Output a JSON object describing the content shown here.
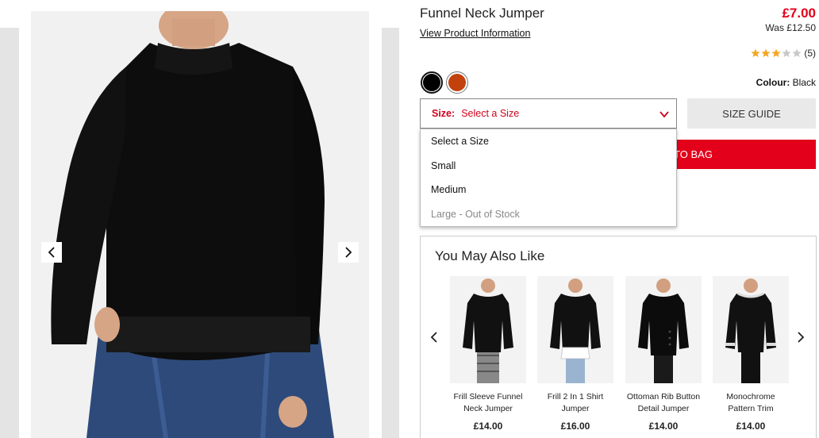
{
  "product": {
    "title": "Funnel Neck Jumper",
    "info_link": "View Product Information",
    "price": "£7.00",
    "was_price": "Was £12.50",
    "rating": 3,
    "rating_max": 5,
    "review_count": "(5)",
    "colour_label": "Colour:",
    "colour_value": "Black",
    "swatches": [
      {
        "name": "Black",
        "color": "#000000"
      },
      {
        "name": "Rust",
        "color": "#c2410c"
      }
    ]
  },
  "size": {
    "label": "Size:",
    "value": "Select a Size",
    "options": [
      "Select a Size",
      "Small",
      "Medium",
      "Large - Out of Stock"
    ],
    "guide": "SIZE GUIDE"
  },
  "cart": {
    "add_label": "TO BAG"
  },
  "recommendations": {
    "title": "You May Also Like",
    "items": [
      {
        "name": "Frill Sleeve Funnel Neck Jumper",
        "price": "£14.00"
      },
      {
        "name": "Frill 2 In 1 Shirt Jumper",
        "price": "£16.00"
      },
      {
        "name": "Ottoman Rib Button Detail Jumper",
        "price": "£14.00"
      },
      {
        "name": "Monochrome Pattern Trim",
        "price": "£14.00"
      }
    ]
  },
  "colors": {
    "accent": "#e2001a",
    "star": "#f5a623",
    "star_empty": "#c8c8c8"
  }
}
